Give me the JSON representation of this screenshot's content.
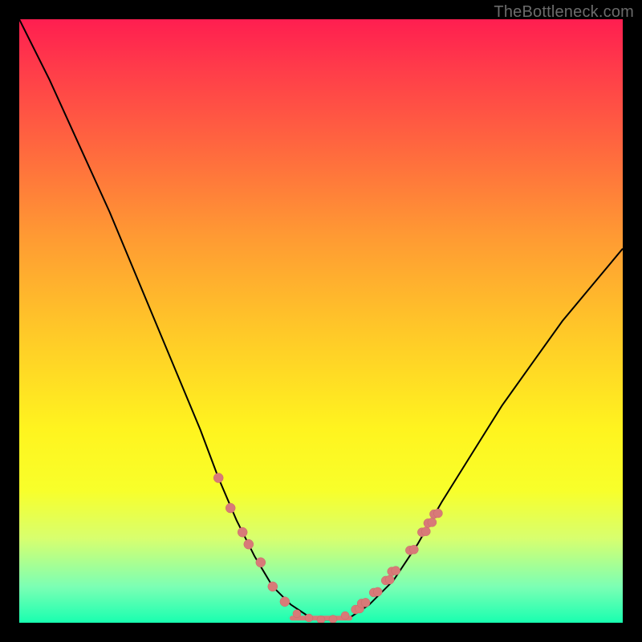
{
  "watermark": "TheBottleneck.com",
  "colors": {
    "page_bg": "#000000",
    "gradient_top": "#ff1e50",
    "gradient_bottom": "#18ffb0",
    "curve": "#000000",
    "marker": "#d87a78"
  },
  "chart_data": {
    "type": "line",
    "title": "",
    "xlabel": "",
    "ylabel": "",
    "xlim": [
      0,
      100
    ],
    "ylim": [
      0,
      100
    ],
    "series": [
      {
        "name": "curve",
        "x": [
          0,
          5,
          10,
          15,
          20,
          25,
          30,
          33,
          36,
          39,
          42,
          45,
          48,
          50,
          52,
          55,
          58,
          62,
          66,
          70,
          75,
          80,
          85,
          90,
          95,
          100
        ],
        "y": [
          100,
          90,
          79,
          68,
          56,
          44,
          32,
          24,
          17,
          11,
          6,
          3,
          1,
          0.5,
          0.5,
          1,
          3,
          7,
          13,
          20,
          28,
          36,
          43,
          50,
          56,
          62
        ]
      }
    ],
    "markers": {
      "left_branch": [
        {
          "x": 33,
          "y": 24
        },
        {
          "x": 35,
          "y": 19
        },
        {
          "x": 37,
          "y": 15
        },
        {
          "x": 38,
          "y": 13
        },
        {
          "x": 40,
          "y": 10
        },
        {
          "x": 42,
          "y": 6
        },
        {
          "x": 44,
          "y": 3.5
        }
      ],
      "valley": [
        {
          "x": 46,
          "y": 1.5
        },
        {
          "x": 48,
          "y": 0.8
        },
        {
          "x": 50,
          "y": 0.5
        },
        {
          "x": 52,
          "y": 0.6
        },
        {
          "x": 54,
          "y": 1.2
        }
      ],
      "right_branch": [
        {
          "x": 56,
          "y": 2.2
        },
        {
          "x": 57,
          "y": 3.2
        },
        {
          "x": 59,
          "y": 5
        },
        {
          "x": 61,
          "y": 7
        },
        {
          "x": 62,
          "y": 8.5
        },
        {
          "x": 65,
          "y": 12
        },
        {
          "x": 67,
          "y": 15
        },
        {
          "x": 68,
          "y": 16.5
        },
        {
          "x": 69,
          "y": 18
        }
      ]
    }
  }
}
